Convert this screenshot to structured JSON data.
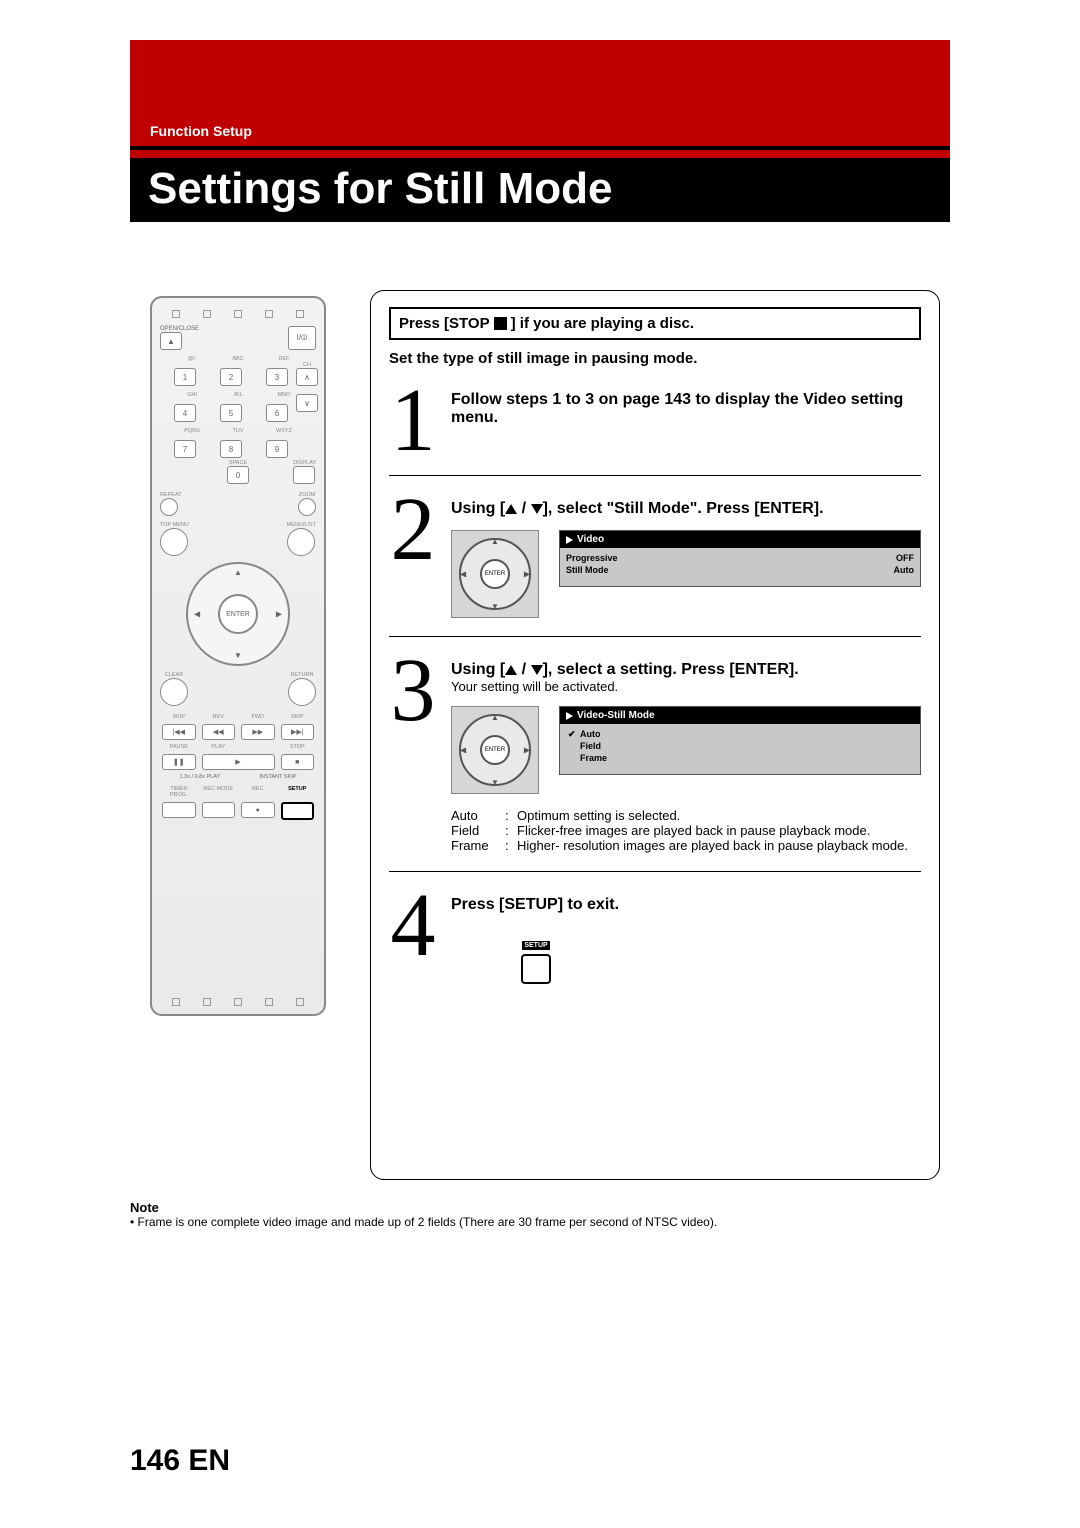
{
  "header": {
    "section": "Function Setup",
    "title": "Settings for Still Mode"
  },
  "intro": {
    "stop_prefix": "Press [STOP ",
    "stop_suffix": "] if you are playing a disc.",
    "subline": "Set the type of still image in pausing mode."
  },
  "steps": {
    "s1": {
      "num": "1",
      "text": "Follow steps 1 to 3 on page 143 to display the Video setting menu."
    },
    "s2": {
      "num": "2",
      "prefix": "Using [",
      "mid": " / ",
      "suffix": "], select \"Still Mode\". Press [ENTER].",
      "menu_title": "Video",
      "menu_rows": [
        {
          "k": "Progressive",
          "v": "OFF"
        },
        {
          "k": "Still Mode",
          "v": "Auto"
        }
      ]
    },
    "s3": {
      "num": "3",
      "prefix": "Using [",
      "mid": " / ",
      "suffix": "], select a setting. Press [ENTER].",
      "sub": "Your setting will be activated.",
      "menu_title": "Video-Still Mode",
      "options": [
        "Auto",
        "Field",
        "Frame"
      ],
      "defs": [
        {
          "k": "Auto",
          "v": "Optimum setting is selected."
        },
        {
          "k": "Field",
          "v": "Flicker-free images are played back in pause playback mode."
        },
        {
          "k": "Frame",
          "v": "Higher- resolution images are played back in pause playback mode."
        }
      ]
    },
    "s4": {
      "num": "4",
      "text": "Press [SETUP] to exit.",
      "btn_label": "SETUP"
    }
  },
  "dpad_center": "ENTER",
  "note": {
    "heading": "Note",
    "text": "• Frame is one complete video image and made up of 2 fields (There are 30 frame per second of NTSC video)."
  },
  "footer": {
    "page": "146",
    "lang": "EN"
  },
  "remote": {
    "open_close": "OPEN/CLOSE",
    "power": "I/⏼",
    "row_labels_1": [
      "@/:",
      "ABC",
      "DEF"
    ],
    "keys_1": [
      "1",
      "2",
      "3"
    ],
    "row_labels_2": [
      "GHI",
      "JKL",
      "MNO"
    ],
    "keys_2": [
      "4",
      "5",
      "6"
    ],
    "row_labels_3": [
      "PQRS",
      "TUV",
      "WXYZ"
    ],
    "keys_3": [
      "7",
      "8",
      "9"
    ],
    "space": "SPACE",
    "zero": "0",
    "ch": "CH",
    "display": "DISPLAY",
    "repeat": "REPEAT",
    "zoom": "ZOOM",
    "top_menu": "TOP MENU",
    "menu_list": "MENU/LIST",
    "enter": "ENTER",
    "clear": "CLEAR",
    "return": "RETURN",
    "transport_labels": [
      "SKIP",
      "REV",
      "FWD",
      "SKIP"
    ],
    "transport2_labels": [
      "PAUSE",
      "PLAY",
      "",
      "STOP"
    ],
    "speed": "1.3x / 0.8x PLAY",
    "instant": "INSTANT SKIP",
    "bottom_labels": [
      "TIMER PROG.",
      "REC MODE",
      "REC",
      "SETUP"
    ]
  }
}
